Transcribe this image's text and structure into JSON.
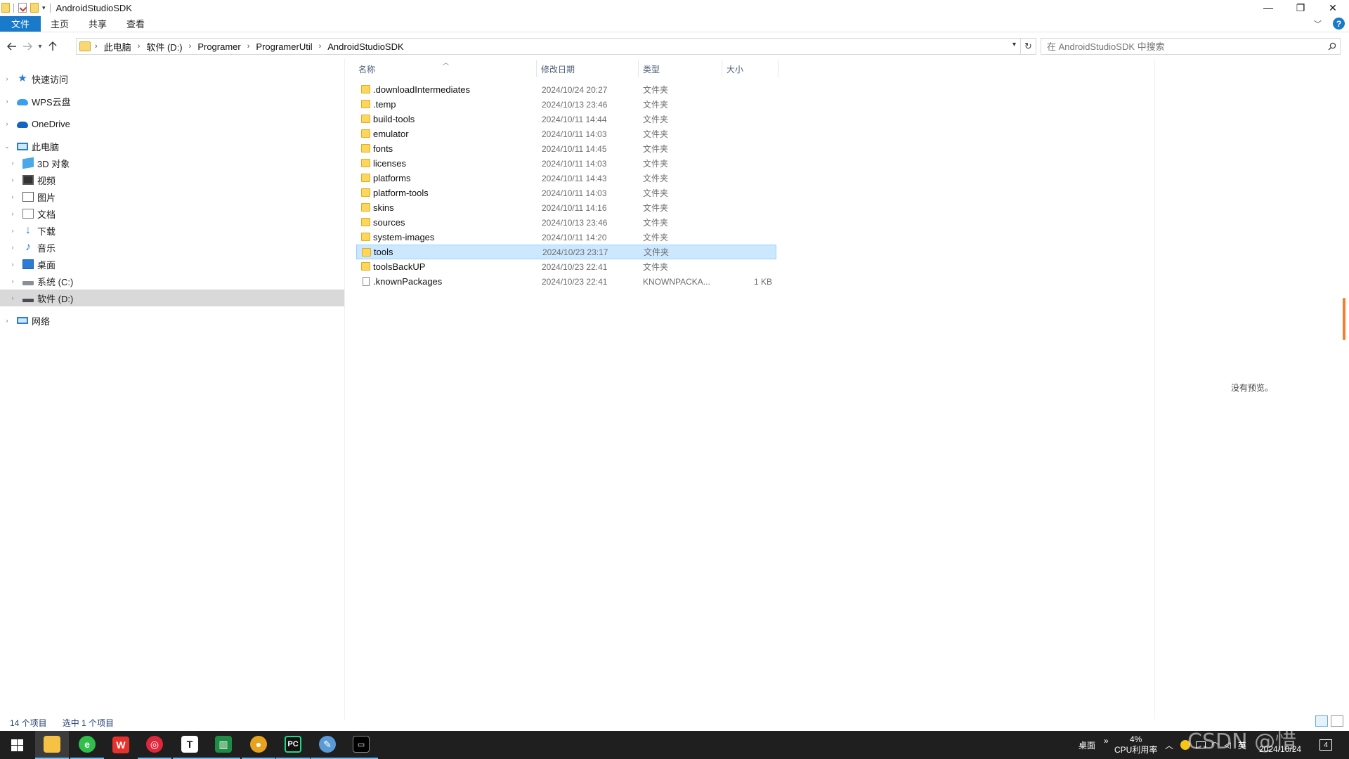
{
  "window": {
    "title": "AndroidStudioSDK",
    "controls": {
      "minimize": "—",
      "maximize": "❐",
      "close": "✕"
    }
  },
  "ribbon": {
    "tabs": [
      "文件",
      "主页",
      "共享",
      "查看"
    ],
    "help": "?"
  },
  "address": {
    "crumbs": [
      "此电脑",
      "软件 (D:)",
      "Programer",
      "ProgramerUtil",
      "AndroidStudioSDK"
    ]
  },
  "search": {
    "placeholder": "在 AndroidStudioSDK 中搜索"
  },
  "nav": {
    "quick_access": "快速访问",
    "wps_cloud": "WPS云盘",
    "onedrive": "OneDrive",
    "this_pc": "此电脑",
    "objects_3d": "3D 对象",
    "videos": "视频",
    "pictures": "图片",
    "documents": "文档",
    "downloads": "下载",
    "music": "音乐",
    "desktop": "桌面",
    "drive_c": "系统 (C:)",
    "drive_d": "软件 (D:)",
    "network": "网络"
  },
  "columns": {
    "name": "名称",
    "modified": "修改日期",
    "type": "类型",
    "size": "大小"
  },
  "files": [
    {
      "name": ".downloadIntermediates",
      "modified": "2024/10/24 20:27",
      "type": "文件夹",
      "size": ""
    },
    {
      "name": ".temp",
      "modified": "2024/10/13 23:46",
      "type": "文件夹",
      "size": ""
    },
    {
      "name": "build-tools",
      "modified": "2024/10/11 14:44",
      "type": "文件夹",
      "size": ""
    },
    {
      "name": "emulator",
      "modified": "2024/10/11 14:03",
      "type": "文件夹",
      "size": ""
    },
    {
      "name": "fonts",
      "modified": "2024/10/11 14:45",
      "type": "文件夹",
      "size": ""
    },
    {
      "name": "licenses",
      "modified": "2024/10/11 14:03",
      "type": "文件夹",
      "size": ""
    },
    {
      "name": "platforms",
      "modified": "2024/10/11 14:43",
      "type": "文件夹",
      "size": ""
    },
    {
      "name": "platform-tools",
      "modified": "2024/10/11 14:03",
      "type": "文件夹",
      "size": ""
    },
    {
      "name": "skins",
      "modified": "2024/10/11 14:16",
      "type": "文件夹",
      "size": ""
    },
    {
      "name": "sources",
      "modified": "2024/10/13 23:46",
      "type": "文件夹",
      "size": ""
    },
    {
      "name": "system-images",
      "modified": "2024/10/11 14:20",
      "type": "文件夹",
      "size": ""
    },
    {
      "name": "tools",
      "modified": "2024/10/23 23:17",
      "type": "文件夹",
      "size": ""
    },
    {
      "name": "toolsBackUP",
      "modified": "2024/10/23 22:41",
      "type": "文件夹",
      "size": ""
    },
    {
      "name": ".knownPackages",
      "modified": "2024/10/23 22:41",
      "type": "KNOWNPACKA...",
      "size": "1 KB"
    }
  ],
  "selected_file": "tools",
  "preview": {
    "empty_text": "没有预览。"
  },
  "status": {
    "count": "14 个项目",
    "selected": "选中 1 个项目"
  },
  "taskbar": {
    "desktop_label": "桌面",
    "overflow": "»",
    "cpu_percent": "4%",
    "cpu_label": "CPU利用率",
    "ime": "英",
    "date": "2024/10/24",
    "notification_count": "4",
    "app_icons": [
      "windows-start",
      "file-explorer",
      "browser",
      "wps-office",
      "netease-music",
      "typora",
      "excel-like",
      "chrome-like",
      "pycharm",
      "paint-app",
      "terminal"
    ]
  },
  "watermark": "CSDN @惜"
}
